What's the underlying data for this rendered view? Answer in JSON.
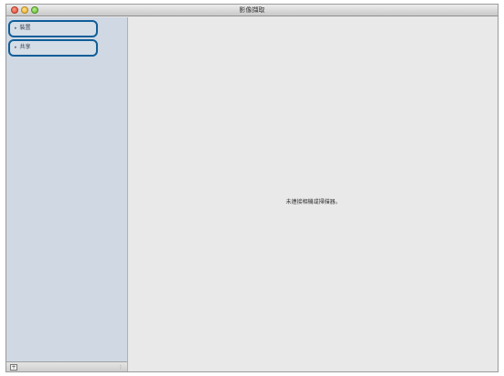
{
  "window": {
    "title": "影像擷取"
  },
  "sidebar": {
    "items": [
      {
        "label": "裝置"
      },
      {
        "label": "共享"
      }
    ]
  },
  "main": {
    "empty_message": "未連接相機或掃描器。"
  },
  "icons": {
    "disclosure": "disclosure-triangle-icon",
    "add": "add-icon",
    "resize": "resize-handle-icon"
  },
  "colors": {
    "highlight_border": "#0f5e99",
    "sidebar_bg": "#cfd8e3"
  }
}
